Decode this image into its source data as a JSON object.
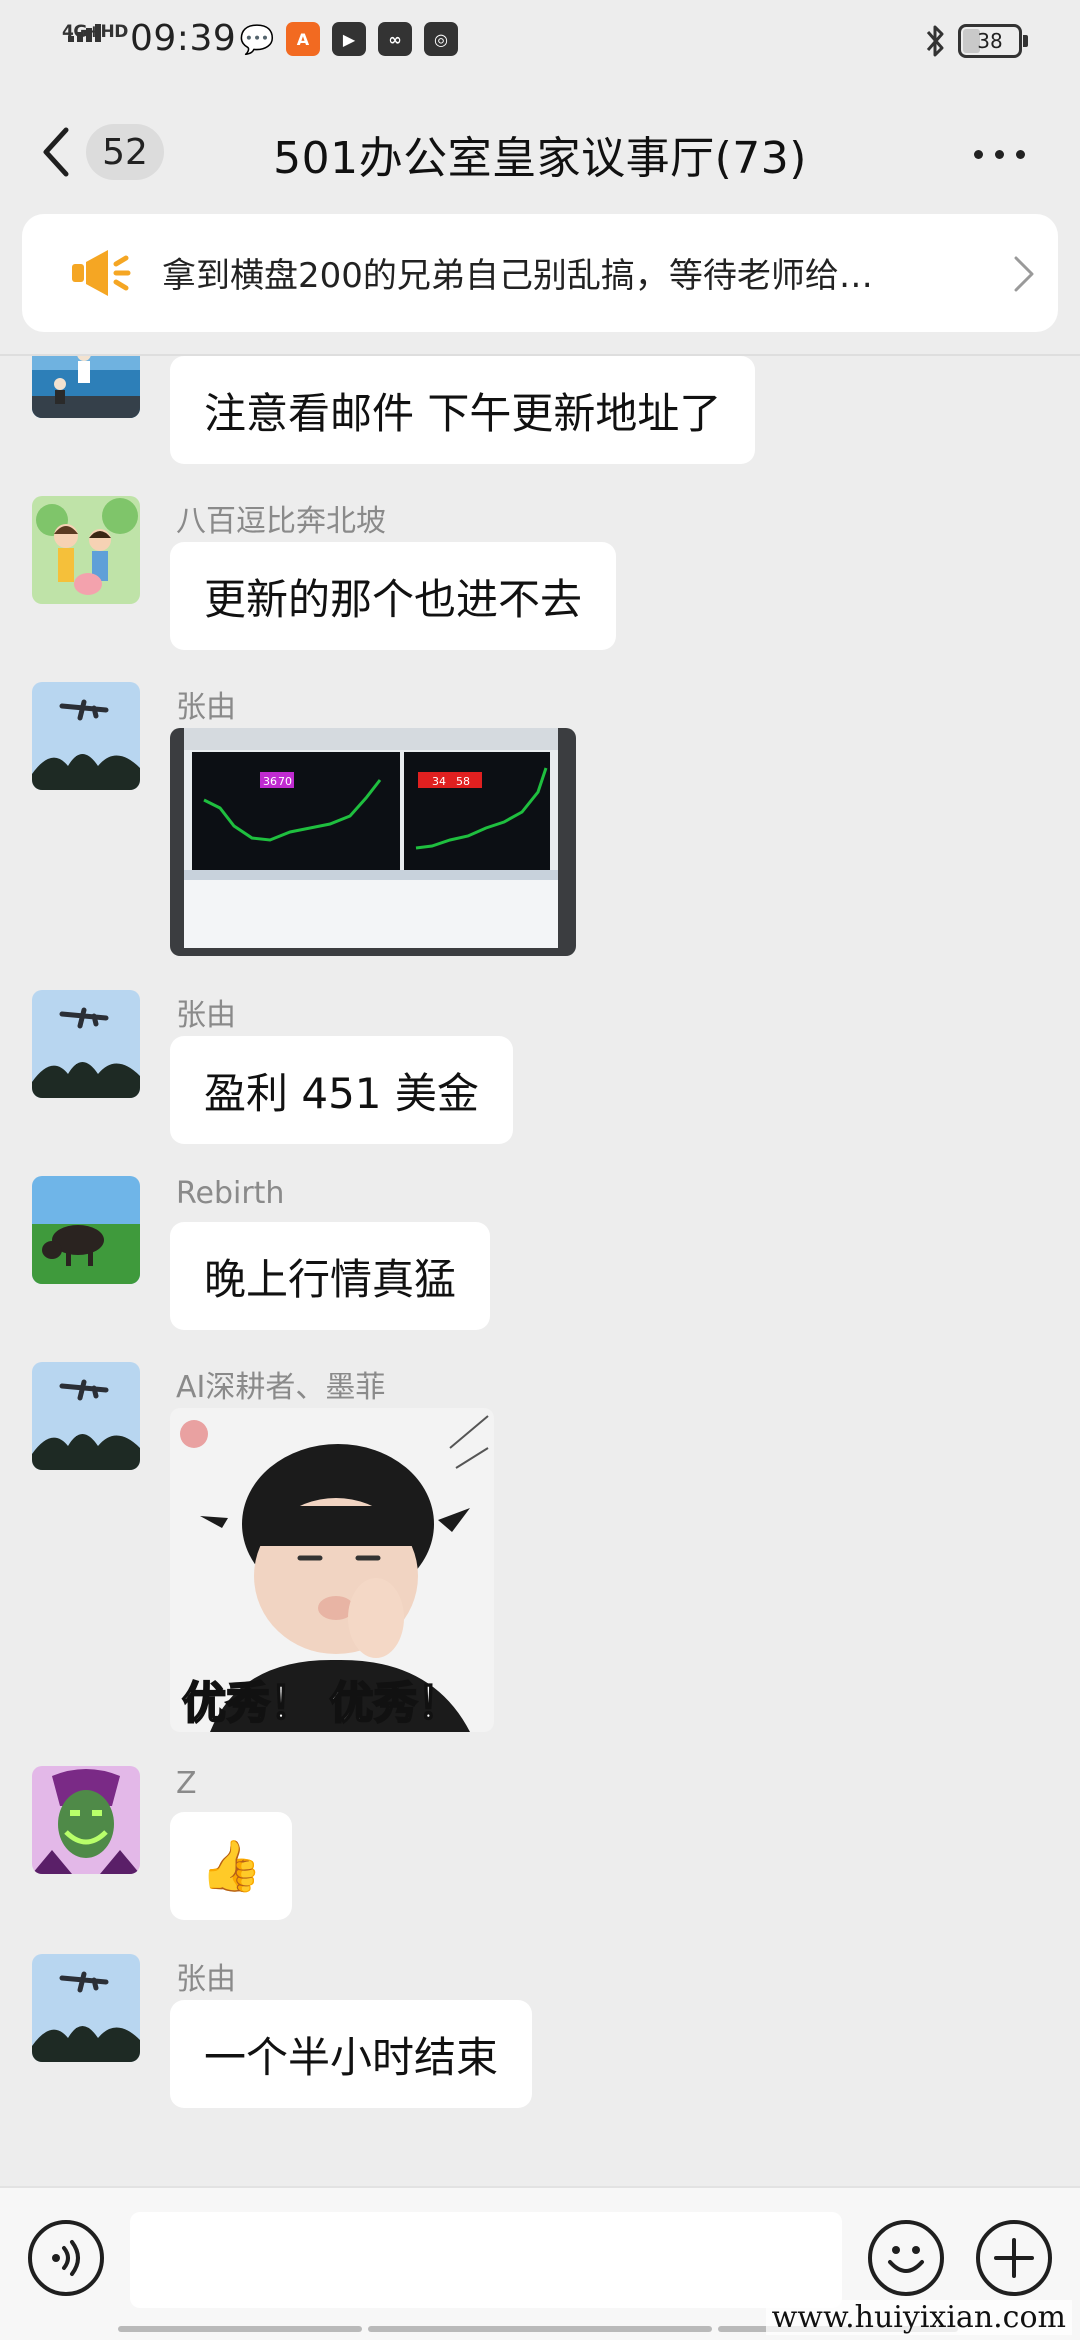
{
  "status_bar": {
    "network": "4G+HD",
    "time": "09:39",
    "battery": "38",
    "app_icons": [
      "wechat-icon",
      "orange-app-icon",
      "play-app-icon",
      "link-app-icon",
      "qq-icon"
    ]
  },
  "nav": {
    "unread_count": "52",
    "title": "501办公室皇家议事厅(73)"
  },
  "announcement": {
    "text": "拿到横盘200的兄弟自己别乱搞，等待老师给…",
    "icon": "megaphone-icon",
    "accent": "#f5a623"
  },
  "messages": [
    {
      "sender": "",
      "type": "text",
      "text": "注意看邮件  下午更新地址了"
    },
    {
      "sender": "八百逗比奔北坡",
      "type": "text",
      "text": "更新的那个也进不去"
    },
    {
      "sender": "张由",
      "type": "image",
      "chart_badges_left": [
        "36",
        "70"
      ],
      "chart_badges_right": [
        "34",
        "58"
      ]
    },
    {
      "sender": "张由",
      "type": "text",
      "text": "盈利 451 美金"
    },
    {
      "sender": "Rebirth",
      "type": "text",
      "text": "晚上行情真猛"
    },
    {
      "sender": "AI深耕者、墨菲",
      "type": "sticker",
      "caption": "优秀！ 优秀！"
    },
    {
      "sender": "Z",
      "type": "emoji",
      "text": "👍"
    },
    {
      "sender": "张由",
      "type": "text",
      "text": "一个半小时结束"
    }
  ],
  "input": {
    "placeholder": "",
    "value": ""
  },
  "watermark": "www.huiyixian.com",
  "colors": {
    "background": "#ededed",
    "bubble": "#ffffff",
    "chart_up": "#1fbf3f",
    "badge_left": "#c02bd0",
    "badge_right": "#e02020"
  }
}
